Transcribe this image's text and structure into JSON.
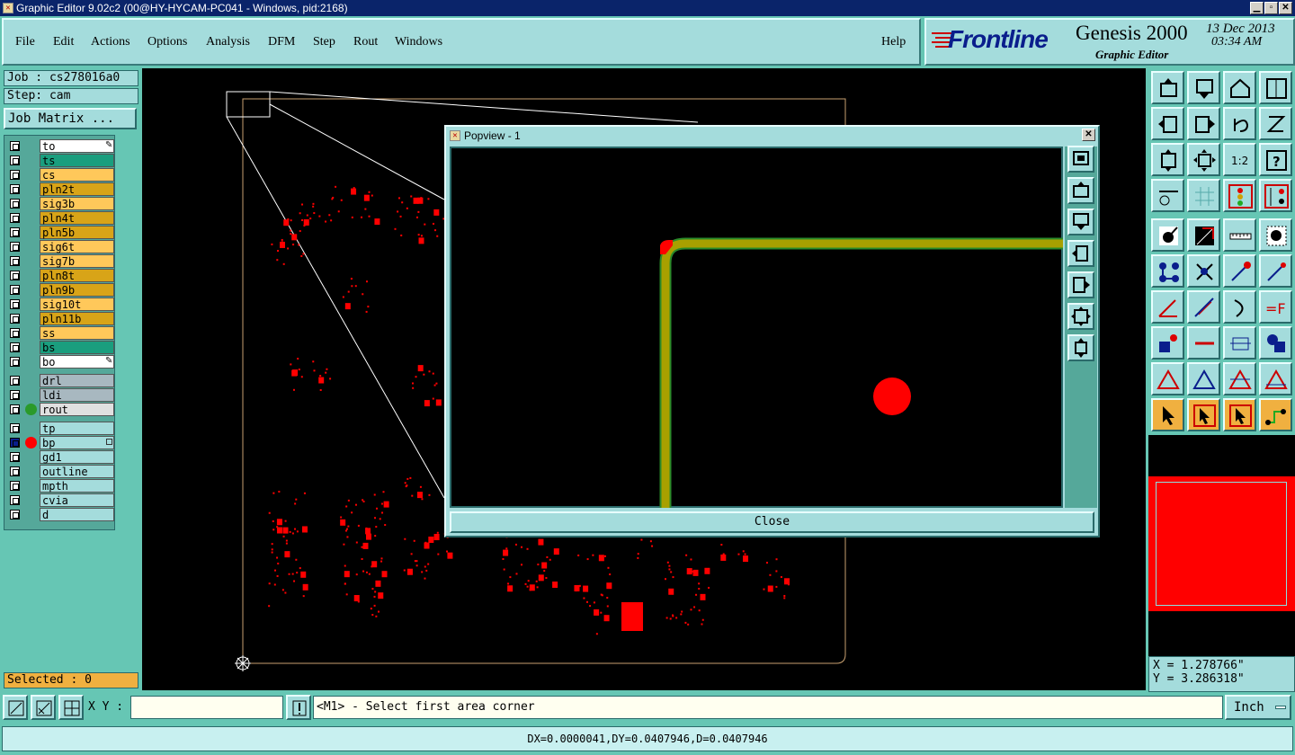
{
  "window": {
    "title": "Graphic Editor 9.02c2 (00@HY-HYCAM-PC041 - Windows, pid:2168)"
  },
  "menu": {
    "items": [
      "File",
      "Edit",
      "Actions",
      "Options",
      "Analysis",
      "DFM",
      "Step",
      "Rout",
      "Windows"
    ],
    "help": "Help"
  },
  "brand": {
    "logo": "Frontline",
    "product": "Genesis 2000",
    "subtitle": "Graphic Editor",
    "date": "13 Dec 2013",
    "time": "03:34 AM"
  },
  "job": {
    "job_label": "Job : cs278016a0",
    "step_label": "Step: cam",
    "matrix_button": "Job Matrix ..."
  },
  "layers": {
    "group1": [
      {
        "name": "to",
        "color": "#ffffff",
        "marker": true
      },
      {
        "name": "ts",
        "color": "#1a9e7e"
      },
      {
        "name": "cs",
        "color": "#ffc85a"
      },
      {
        "name": "pln2t",
        "color": "#d8a418"
      },
      {
        "name": "sig3b",
        "color": "#ffc85a"
      },
      {
        "name": "pln4t",
        "color": "#d8a418"
      },
      {
        "name": "pln5b",
        "color": "#d8a418"
      },
      {
        "name": "sig6t",
        "color": "#ffc85a"
      },
      {
        "name": "sig7b",
        "color": "#ffc85a"
      },
      {
        "name": "pln8t",
        "color": "#d8a418"
      },
      {
        "name": "pln9b",
        "color": "#d8a418"
      },
      {
        "name": "sig10t",
        "color": "#ffc85a"
      },
      {
        "name": "pln11b",
        "color": "#d8a418"
      },
      {
        "name": "ss",
        "color": "#ffc85a"
      },
      {
        "name": "bs",
        "color": "#1a9e7e"
      },
      {
        "name": "bo",
        "color": "#ffffff",
        "marker": true
      }
    ],
    "group2": [
      {
        "name": "drl",
        "color": "#a8b8c0"
      },
      {
        "name": "ldi",
        "color": "#a8b8c0"
      },
      {
        "name": "rout",
        "color": "#e0e0e0",
        "dot": "#2a9a2a"
      }
    ],
    "group3": [
      {
        "name": "tp",
        "color": "#a4dcdc"
      },
      {
        "name": "bp",
        "color": "#a4dcdc",
        "dot": "#ff0000",
        "active": true
      },
      {
        "name": "gd1",
        "color": "#a4dcdc"
      },
      {
        "name": "outline",
        "color": "#a4dcdc"
      },
      {
        "name": "mpth",
        "color": "#a4dcdc"
      },
      {
        "name": "cvia",
        "color": "#a4dcdc"
      },
      {
        "name": "d",
        "color": "#a4dcdc"
      }
    ]
  },
  "selected": "Selected : 0",
  "popview": {
    "title": "Popview - 1",
    "close_label": "Close"
  },
  "coords": {
    "x": "X = 1.278766\"",
    "y": "Y = 3.286318\""
  },
  "bottombar": {
    "xy_label": "X Y :",
    "xy_value": "",
    "prompt": "<M1> - Select first area corner",
    "unit": "Inch"
  },
  "statusbar": {
    "text": "DX=0.0000041,DY=0.0407946,D=0.0407946"
  },
  "toolbox": {
    "rows": [
      [
        "import-icon",
        "export-icon",
        "home-icon",
        "split-view-icon"
      ],
      [
        "left-icon",
        "right-icon",
        "undo-icon",
        "redo-icon"
      ],
      [
        "fit-vertical-icon",
        "fit-all-icon",
        "one-to-two-icon",
        "help-icon"
      ],
      [
        "settings-icon",
        "grid-icon",
        "layer-toggle-icon",
        "layer-toggle-2-icon"
      ],
      [
        "snap-icon",
        "measure-area-icon",
        "ruler-icon",
        "pad-icon"
      ],
      [
        "connect-icon",
        "cross-icon",
        "line-to-pad-icon",
        "line-pad-icon"
      ],
      [
        "angle-icon",
        "line-icon",
        "arc-icon",
        "text-fx-icon"
      ],
      [
        "pad-square-icon",
        "dash-icon",
        "dim-icon",
        "shape-icon"
      ],
      [
        "triangle-icon",
        "triangle-2-icon",
        "triangle-3-icon",
        "triangle-4-icon"
      ],
      [
        "pointer-icon",
        "pointer-box-icon",
        "pointer-box-2-icon",
        "route-icon"
      ]
    ]
  },
  "colors": {
    "panel": "#a4dcdc",
    "background": "#66c6b4",
    "features": "#ff0000",
    "trace": "#a8a000",
    "trace_edge": "#2a8a2a",
    "profile": "#c8a070"
  }
}
